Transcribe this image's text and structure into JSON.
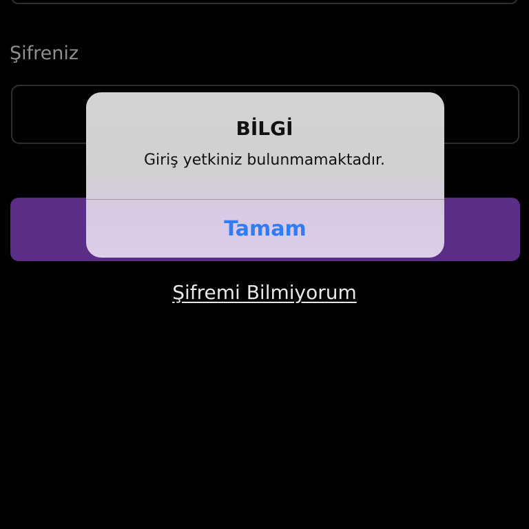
{
  "form": {
    "password_label": "Şifreniz",
    "forgot_password_link": "Şifremi Bilmiyorum"
  },
  "alert": {
    "title": "BİLGİ",
    "message": "Giriş yetkiniz bulunmamaktadır.",
    "ok_button": "Tamam"
  },
  "colors": {
    "background": "#000000",
    "login_button": "#5a2d86",
    "alert_action": "#2f7cf6"
  }
}
